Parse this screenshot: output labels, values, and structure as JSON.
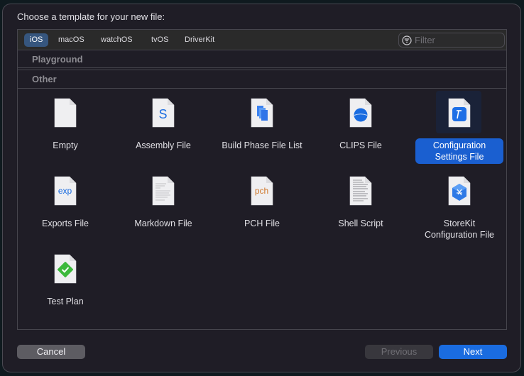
{
  "dialog": {
    "prompt": "Choose a template for your new file:"
  },
  "platform_tabs": [
    {
      "label": "iOS",
      "selected": true
    },
    {
      "label": "macOS",
      "selected": false
    },
    {
      "label": "watchOS",
      "selected": false
    },
    {
      "label": "tvOS",
      "selected": false
    },
    {
      "label": "DriverKit",
      "selected": false
    }
  ],
  "filter": {
    "placeholder": "Filter",
    "value": "",
    "icon": "filter-icon"
  },
  "sections": {
    "playground": "Playground",
    "other": "Other"
  },
  "templates": [
    {
      "label": "Empty",
      "icon": "empty-file-icon",
      "selected": false
    },
    {
      "label": "Assembly File",
      "icon": "assembly-file-icon",
      "glyph": "S",
      "glyph_color": "#1a6ce0",
      "selected": false
    },
    {
      "label": "Build Phase File List",
      "icon": "build-phase-file-list-icon",
      "selected": false
    },
    {
      "label": "CLIPS File",
      "icon": "clips-file-icon",
      "selected": false
    },
    {
      "label": "Configuration Settings File",
      "icon": "configuration-settings-file-icon",
      "selected": true
    },
    {
      "label": "Exports File",
      "icon": "exports-file-icon",
      "glyph": "exp",
      "glyph_color": "#1a6ce0",
      "selected": false
    },
    {
      "label": "Markdown File",
      "icon": "markdown-file-icon",
      "selected": false
    },
    {
      "label": "PCH File",
      "icon": "pch-file-icon",
      "glyph": "pch",
      "glyph_color": "#d0782a",
      "selected": false
    },
    {
      "label": "Shell Script",
      "icon": "shell-script-icon",
      "selected": false
    },
    {
      "label": "StoreKit Configuration File",
      "icon": "storekit-configuration-file-icon",
      "selected": false
    },
    {
      "label": "Test Plan",
      "icon": "test-plan-icon",
      "selected": false
    }
  ],
  "buttons": {
    "cancel": "Cancel",
    "previous": "Previous",
    "next": "Next"
  },
  "colors": {
    "accent": "#1a6ce0",
    "selected_tab": "#36567e",
    "selection": "#1a5fd0",
    "test_plan_green": "#3cb93c"
  }
}
